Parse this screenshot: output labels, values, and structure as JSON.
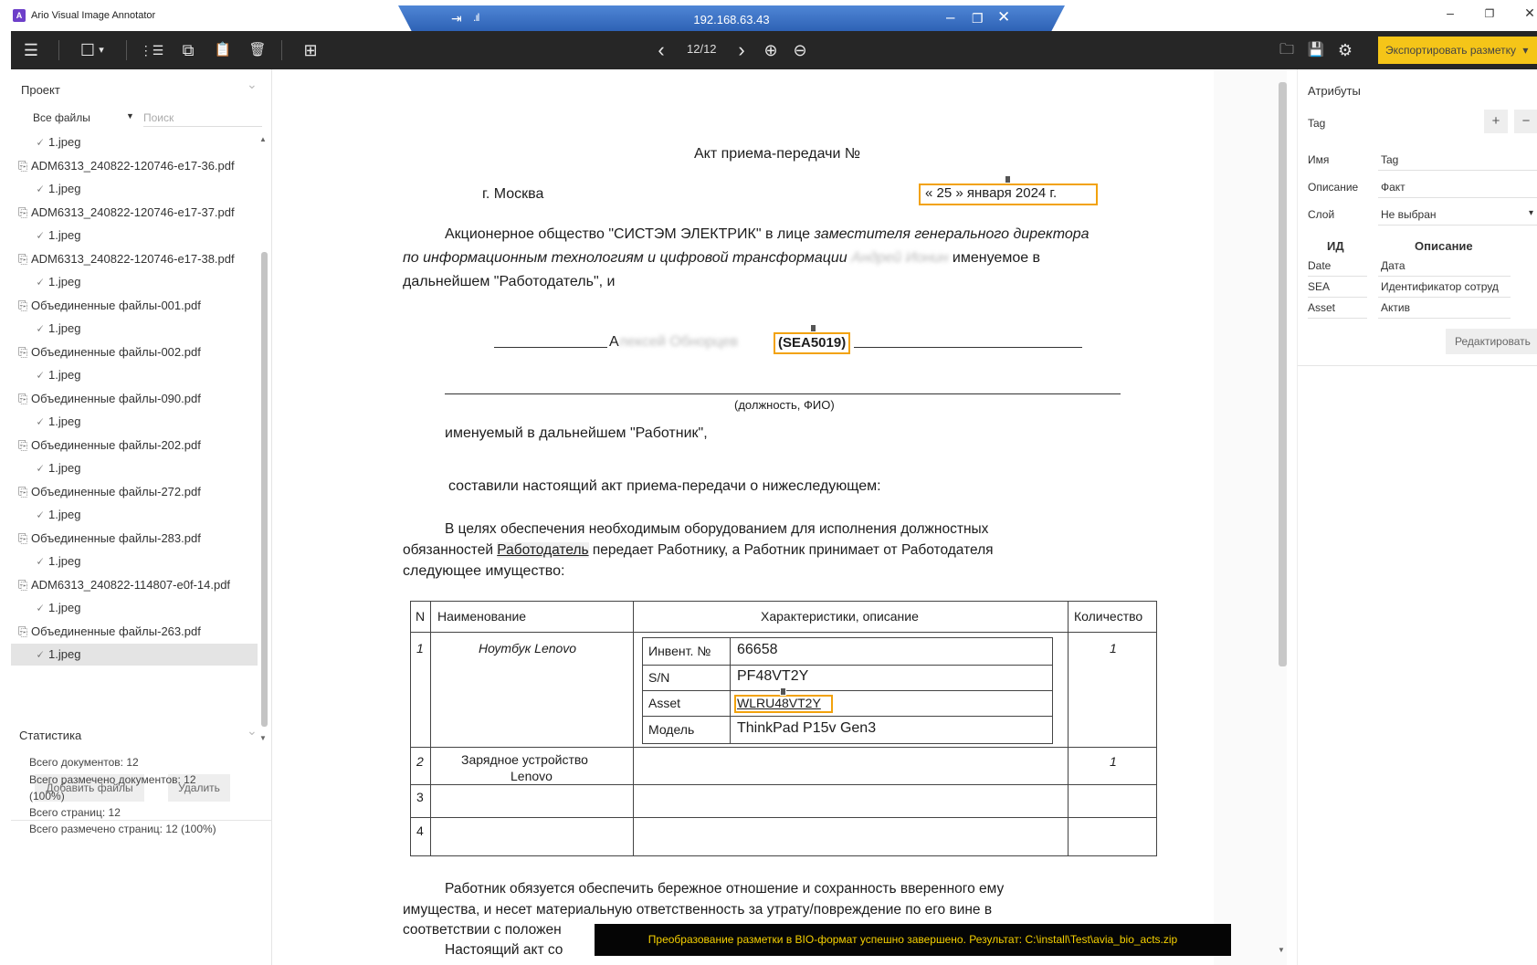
{
  "app": {
    "title": "Ario Visual Image Annotator",
    "logo_letter": "A",
    "window_controls": {
      "minimize": "–",
      "restore": "❐",
      "close": "✕"
    }
  },
  "remote_bar": {
    "ip": "192.168.63.43",
    "pin_icon": "⇥",
    "signal_icon": ".ıl",
    "minimize": "–",
    "restore": "❐",
    "close": "✕"
  },
  "toolbar": {
    "menu_icon": "☰",
    "rect_icon": "☐",
    "rect_dropdown_icon": "▾",
    "list_icon": "⋮☰",
    "copy_icon": "⧉",
    "paste_icon": "📋",
    "delete_icon": "🗑",
    "grid_icon": "⊞",
    "prev_icon": "‹",
    "page_counter": "12/12",
    "next_icon": "›",
    "zoom_in_icon": "⊕",
    "zoom_out_icon": "⊖",
    "open_icon": "🗀",
    "save_icon": "💾",
    "settings_icon": "⚙",
    "export_label": "Экспортировать разметку",
    "export_arrow": "▾"
  },
  "project_panel": {
    "title": "Проект",
    "collapse_icon": "⌄",
    "filter_value": "Все файлы",
    "filter_arrow": "▼",
    "search_placeholder": "Поиск",
    "files": [
      {
        "type": "jpg",
        "label": "1.jpeg",
        "icon": "🗸"
      },
      {
        "type": "pdf",
        "label": "ADM6313_240822-120746-e17-36.pdf",
        "icon": "⎘"
      },
      {
        "type": "jpg",
        "label": "1.jpeg",
        "icon": "🗸"
      },
      {
        "type": "pdf",
        "label": "ADM6313_240822-120746-e17-37.pdf",
        "icon": "⎘"
      },
      {
        "type": "jpg",
        "label": "1.jpeg",
        "icon": "🗸"
      },
      {
        "type": "pdf",
        "label": "ADM6313_240822-120746-e17-38.pdf",
        "icon": "⎘"
      },
      {
        "type": "jpg",
        "label": "1.jpeg",
        "icon": "🗸"
      },
      {
        "type": "pdf",
        "label": "Объединенные файлы-001.pdf",
        "icon": "⎘"
      },
      {
        "type": "jpg",
        "label": "1.jpeg",
        "icon": "🗸"
      },
      {
        "type": "pdf",
        "label": "Объединенные файлы-002.pdf",
        "icon": "⎘"
      },
      {
        "type": "jpg",
        "label": "1.jpeg",
        "icon": "🗸"
      },
      {
        "type": "pdf",
        "label": "Объединенные файлы-090.pdf",
        "icon": "⎘"
      },
      {
        "type": "jpg",
        "label": "1.jpeg",
        "icon": "🗸"
      },
      {
        "type": "pdf",
        "label": "Объединенные файлы-202.pdf",
        "icon": "⎘"
      },
      {
        "type": "jpg",
        "label": "1.jpeg",
        "icon": "🗸"
      },
      {
        "type": "pdf",
        "label": "Объединенные файлы-272.pdf",
        "icon": "⎘"
      },
      {
        "type": "jpg",
        "label": "1.jpeg",
        "icon": "🗸"
      },
      {
        "type": "pdf",
        "label": "Объединенные файлы-283.pdf",
        "icon": "⎘"
      },
      {
        "type": "jpg",
        "label": "1.jpeg",
        "icon": "🗸"
      },
      {
        "type": "pdf",
        "label": "ADM6313_240822-114807-e0f-14.pdf",
        "icon": "⎘"
      },
      {
        "type": "jpg",
        "label": "1.jpeg",
        "icon": "🗸"
      },
      {
        "type": "pdf",
        "label": "Объединенные файлы-263.pdf",
        "icon": "⎘"
      },
      {
        "type": "jpg",
        "label": "1.jpeg",
        "icon": "🗸",
        "selected": true
      }
    ],
    "add_files_label": "Добавить файлы",
    "delete_label": "Удалить",
    "scroll_up": "▲",
    "scroll_down": "▼"
  },
  "stats_panel": {
    "title": "Статистика",
    "collapse_icon": "⌄",
    "lines": [
      "Всего документов: 12",
      "Всего размечено документов: 12",
      "(100%)",
      "Всего страниц: 12",
      "Всего размечено страниц: 12 (100%)"
    ]
  },
  "document": {
    "title": "Акт приема-передачи  №",
    "city": "г. Москва",
    "date_text": "« 25 » января  2024 г.",
    "para1_line1_regular": "Акционерное общество \"СИСТЭМ ЭЛЕКТРИК\" в лице ",
    "para1_line1_italic": "заместителя генерального директора",
    "para1_line2_italic": "по информационным технологиям и цифровой трансформации",
    "para1_line2_blurred": "Андрей Ионин",
    "para1_line2_end": "именуемое в",
    "para1_line3": "дальнейшем \"Работодатель\", и",
    "employee_prefix": "А",
    "employee_blurred": "лексей Обнорцев",
    "employee_code": "(SEA5019)",
    "position_caption": "(должность, ФИО)",
    "employee_named": "именуемый в дальнейшем \"Работник\",",
    "drafted": "составили настоящий акт приема-передачи о нижеследующем:",
    "para2_line1": "В   целях   обеспечения   необходимым   оборудованием   для   исполнения   должностных",
    "para2_line2_start": "обязанностей ",
    "para2_line2_underlined": "Работодатель",
    "para2_line2_end": " передает  Работнику,  а  Работник  принимает  от  Работодателя",
    "para2_line3": "следующее имущество:",
    "table": {
      "headers": [
        "N",
        "Наименование",
        "Характеристики, описание",
        "Количество"
      ],
      "row1_num": "1",
      "row1_name": "Ноутбук Lenovo",
      "row1_qty": "1",
      "specs": [
        {
          "label": "Инвент. №",
          "value": "66658"
        },
        {
          "label": "S/N",
          "value": "PF48VT2Y"
        },
        {
          "label": "Asset",
          "value": "WLRU48VT2Y"
        },
        {
          "label": "Модель",
          "value": "ThinkPad P15v Gen3"
        }
      ],
      "row2_num": "2",
      "row2_name_line1": "Зарядное устройство",
      "row2_name_line2": "Lenovo",
      "row2_qty": "1",
      "row3_num": "3",
      "row4_num": "4"
    },
    "para3_line1": "Работник  обязуется  обеспечить  бережное  отношение  и  сохранность  вверенного  ему",
    "para3_line2": "имущества,  и  несет  материальную  ответственность  за  утрату/повреждение  по  его  вине  в",
    "para3_line3": "соответствии с положен",
    "para4_line1": "Настоящий акт со",
    "scroll_down": "▼"
  },
  "toast": {
    "text": "Преобразование разметки в BIO-формат успешно завершено. Результат: C:\\install\\Test\\avia_bio_acts.zip"
  },
  "attributes_panel": {
    "title": "Атрибуты",
    "tag_label": "Tag",
    "add_icon": "+",
    "remove_icon": "−",
    "name_label": "Имя",
    "name_value": "Tag",
    "description_label": "Описание",
    "description_value": "Факт",
    "layer_label": "Слой",
    "layer_value": "Не выбран",
    "layer_arrow": "▾",
    "table_headers": [
      "ИД",
      "Описание"
    ],
    "rows": [
      {
        "id": "Date",
        "desc": "Дата"
      },
      {
        "id": "SEA",
        "desc": "Идентификатор сотруд"
      },
      {
        "id": "Asset",
        "desc": "Актив"
      }
    ],
    "edit_label": "Редактировать"
  },
  "colors": {
    "toolbar_bg": "#262626",
    "export_yellow": "#f5c518",
    "annotation_orange": "#f2a20c",
    "toast_bg": "#050505",
    "toast_text": "#f5d000",
    "rdp_blue": "#3a70c4"
  }
}
